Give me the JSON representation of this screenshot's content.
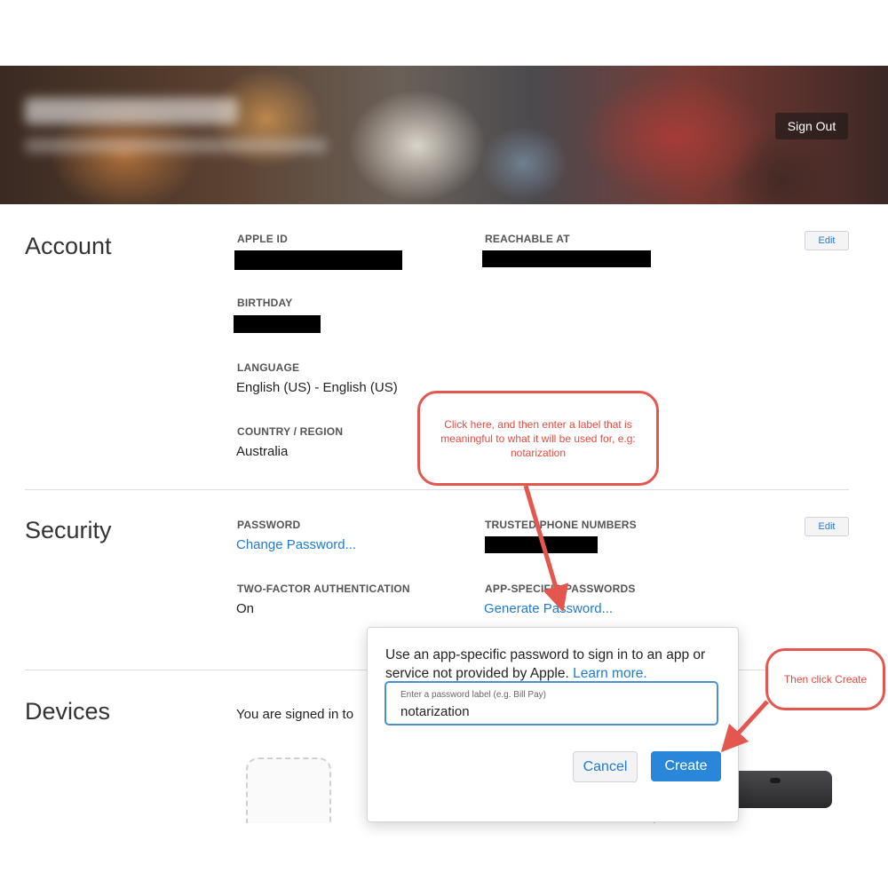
{
  "header": {
    "sign_out_label": "Sign Out"
  },
  "account": {
    "title": "Account",
    "edit_label": "Edit",
    "apple_id_label": "APPLE ID",
    "reachable_label": "REACHABLE AT",
    "birthday_label": "BIRTHDAY",
    "language_label": "LANGUAGE",
    "language_value": "English (US) - English (US)",
    "country_label": "COUNTRY / REGION",
    "country_value": "Australia"
  },
  "security": {
    "title": "Security",
    "edit_label": "Edit",
    "password_label": "PASSWORD",
    "change_password_link": "Change Password...",
    "trusted_label": "TRUSTED PHONE NUMBERS",
    "two_factor_label": "TWO-FACTOR AUTHENTICATION",
    "two_factor_value": "On",
    "app_specific_label": "APP-SPECIFIC PASSWORDS",
    "generate_link": "Generate Password..."
  },
  "devices": {
    "title": "Devices",
    "signed_in_text": "You are signed in to"
  },
  "popover": {
    "text": "Use an app-specific password to sign in to an app or service not provided by Apple.",
    "learn_more": "Learn more.",
    "input_placeholder": "Enter a password label (e.g. Bill Pay)",
    "input_value": "notarization",
    "cancel_label": "Cancel",
    "create_label": "Create"
  },
  "annotations": {
    "callout1": "Click here, and then enter a label that is meaningful to what it will be used for, e.g: notarization",
    "callout2": "Then click Create",
    "color": "#e4574e"
  }
}
